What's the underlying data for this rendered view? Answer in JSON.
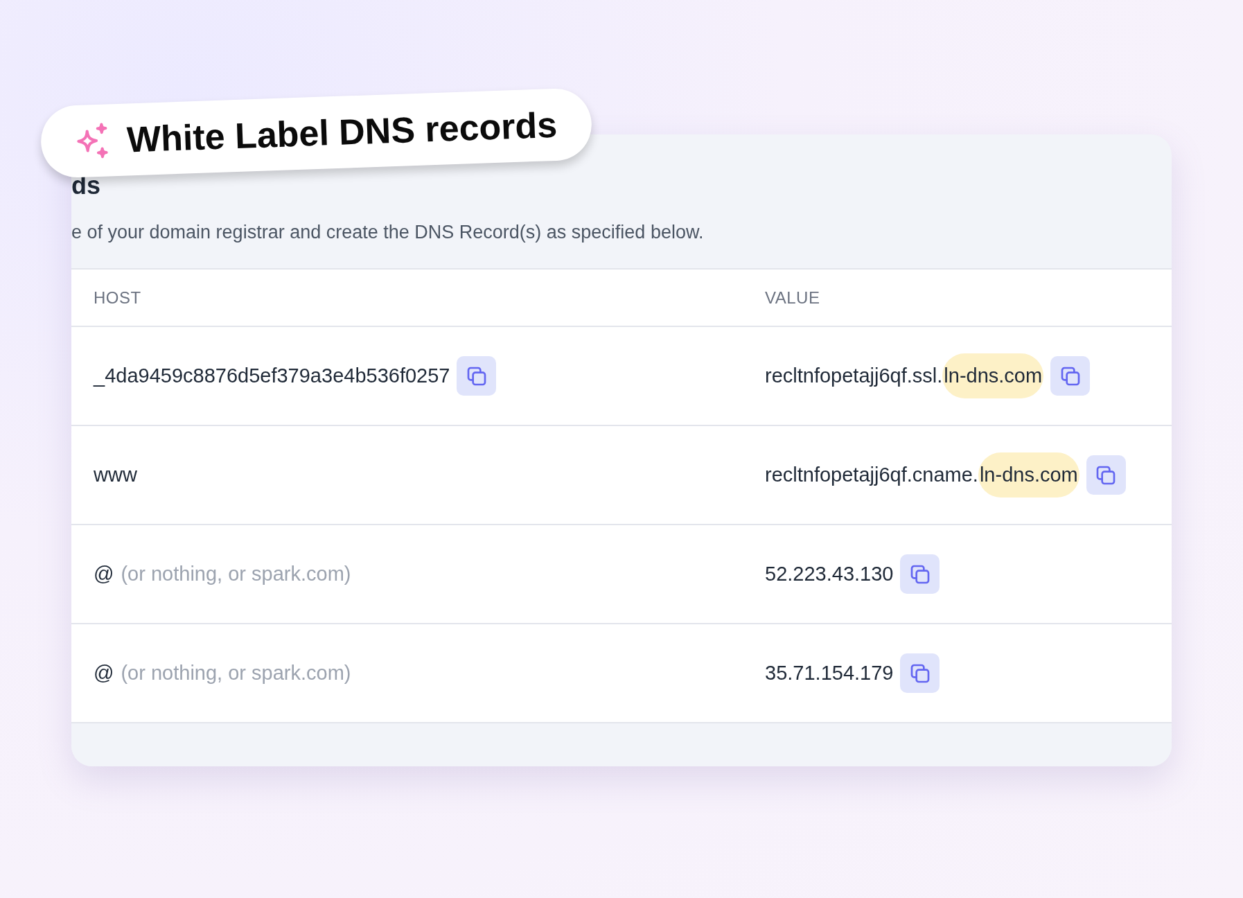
{
  "badge": {
    "title": "White Label DNS records"
  },
  "card": {
    "heading": "ds",
    "description": "e of your domain registrar and create the DNS Record(s) as specified below."
  },
  "table": {
    "columns": [
      "HOST",
      "VALUE"
    ],
    "rows": [
      {
        "host": "_4da9459c8876d5ef379a3e4b536f0257",
        "host_note": null,
        "host_copy": true,
        "value": "recltnfopetajj6qf.ssl.",
        "value_highlight": "ln-dns.com"
      },
      {
        "host": "www",
        "host_note": null,
        "host_copy": false,
        "value": "recltnfopetajj6qf.cname.",
        "value_highlight": "ln-dns.com"
      },
      {
        "host": "@",
        "host_note": "(or nothing, or spark.com)",
        "host_copy": false,
        "value": "52.223.43.130",
        "value_highlight": null
      },
      {
        "host": "@",
        "host_note": "(or nothing, or spark.com)",
        "host_copy": false,
        "value": "35.71.154.179",
        "value_highlight": null
      }
    ]
  }
}
